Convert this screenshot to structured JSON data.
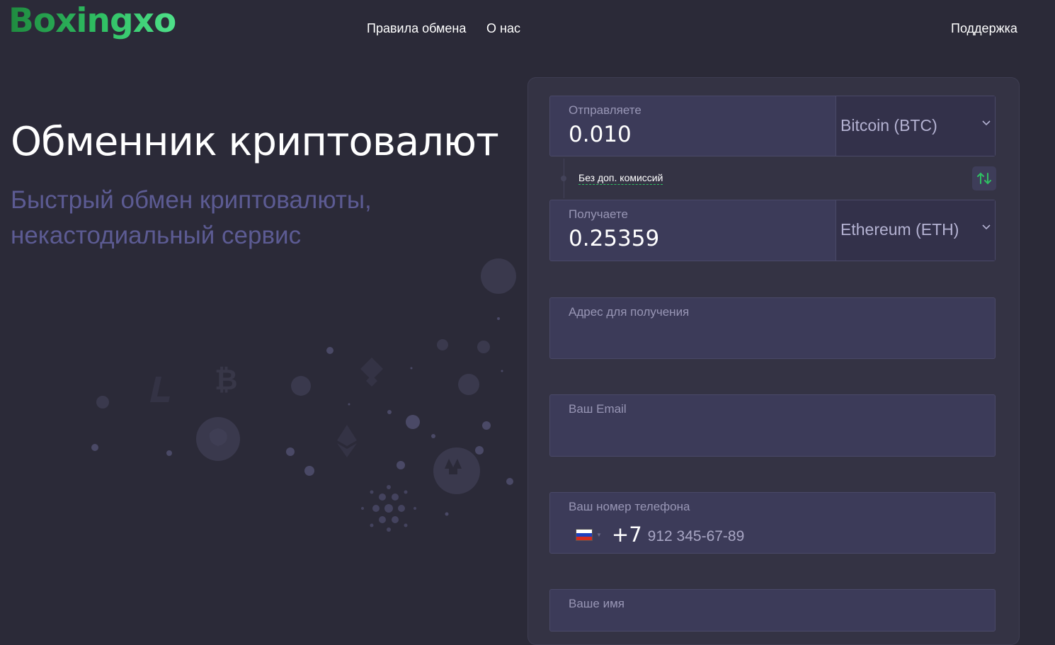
{
  "brand": {
    "name": "Boxingxo"
  },
  "nav": {
    "rules": "Правила обмена",
    "about": "О нас",
    "support": "Поддержка"
  },
  "hero": {
    "title": "Обменник криптовалют",
    "subtitle": "Быстрый обмен криптовалюты, некастодиальный сервис"
  },
  "exchange": {
    "send": {
      "label": "Отправляете",
      "amount": "0.010",
      "currency": "Bitcoin (BTC)"
    },
    "fee_note": "Без доп. комиссий",
    "swap_icon": "swap-arrows-icon",
    "receive": {
      "label": "Получаете",
      "amount": "0.25359",
      "currency": "Ethereum (ETH)"
    },
    "address": {
      "label": "Адрес для получения"
    },
    "email": {
      "label": "Ваш Email"
    },
    "phone": {
      "label": "Ваш номер телефона",
      "country": "RU",
      "code": "+7",
      "placeholder": "912 345-67-89"
    },
    "name": {
      "label": "Ваше имя"
    }
  },
  "colors": {
    "background": "#2b2a38",
    "panel": "#343344",
    "field": "#3c3b59",
    "accent_green": "#2fbf63",
    "subtitle": "#5c5b93"
  }
}
